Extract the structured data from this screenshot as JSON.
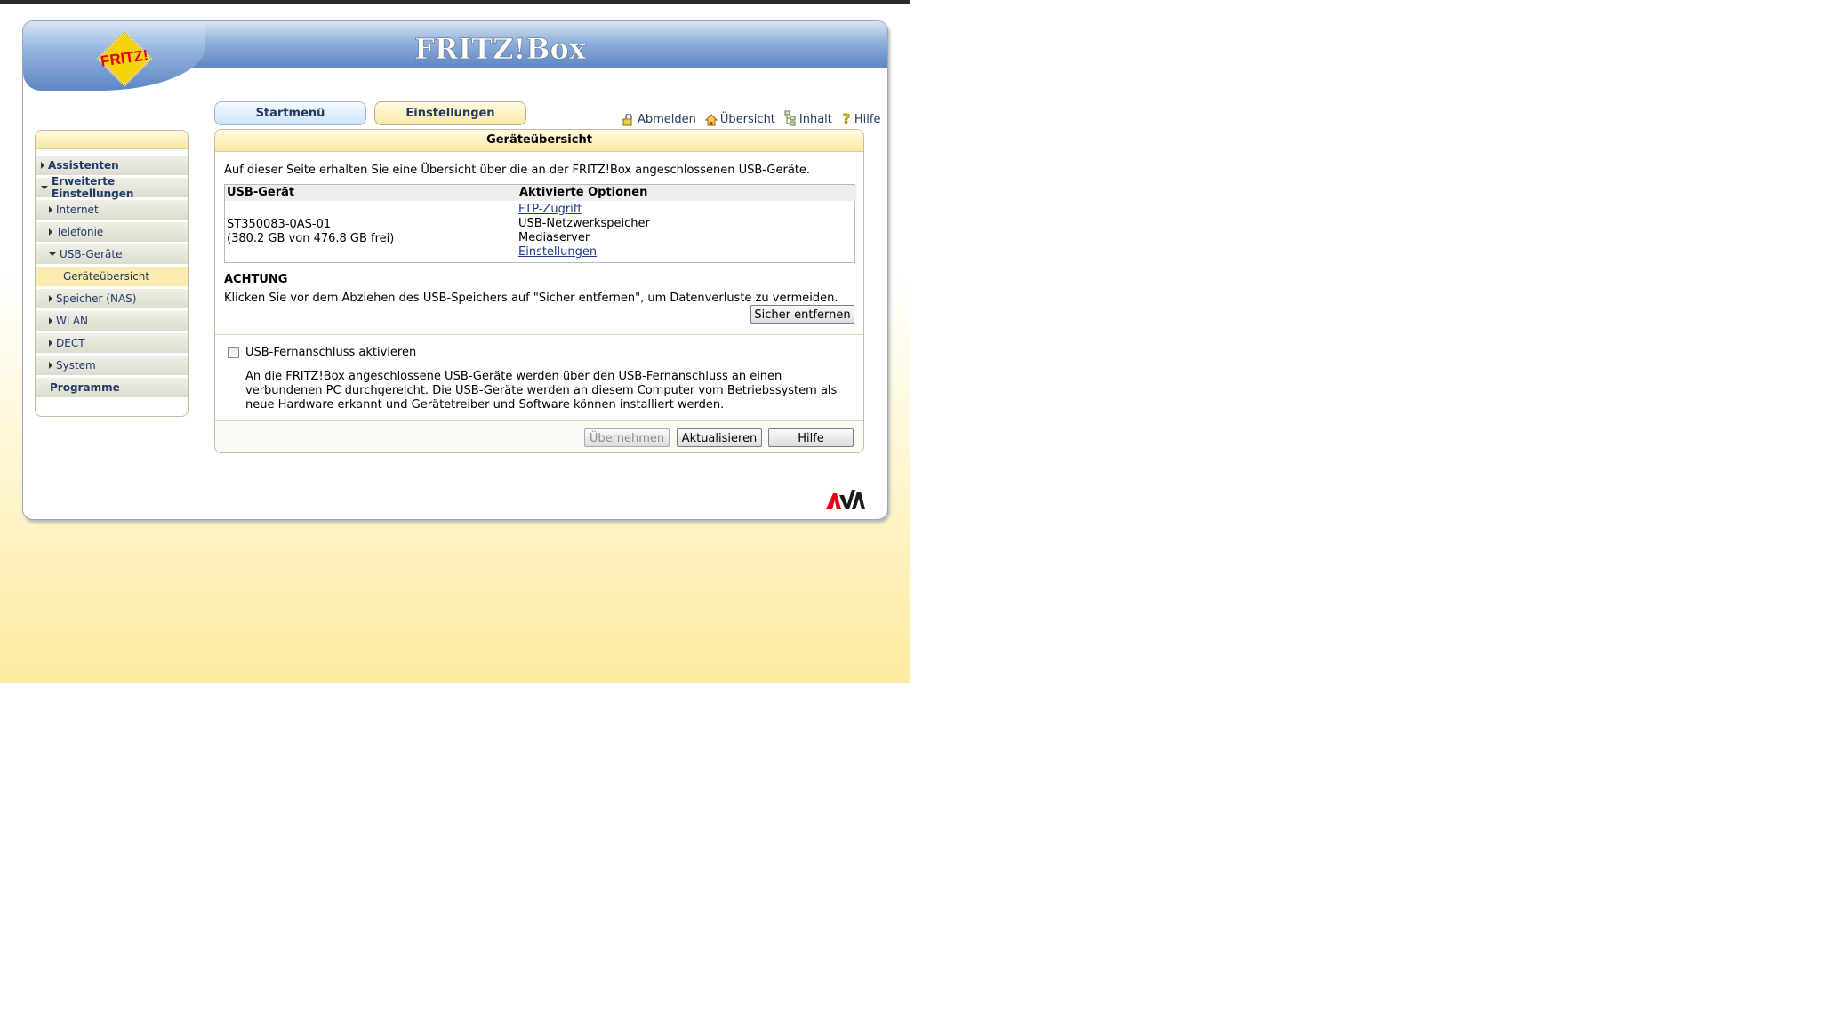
{
  "header": {
    "brand": "FRITZ!Box",
    "logo_text": "FRITZ!"
  },
  "tabs": [
    {
      "label": "Startmenü"
    },
    {
      "label": "Einstellungen"
    }
  ],
  "toplinks": [
    {
      "label": "Abmelden",
      "icon": "logout-icon"
    },
    {
      "label": "Übersicht",
      "icon": "home-icon"
    },
    {
      "label": "Inhalt",
      "icon": "sitemap-icon"
    },
    {
      "label": "Hilfe",
      "icon": "help-icon"
    }
  ],
  "sidebar": {
    "items": [
      {
        "label": "Assistenten"
      },
      {
        "label": "Erweiterte Einstellungen"
      },
      {
        "label": "Internet"
      },
      {
        "label": "Telefonie"
      },
      {
        "label": "USB-Geräte"
      },
      {
        "label": "Geräteübersicht"
      },
      {
        "label": "Speicher (NAS)"
      },
      {
        "label": "WLAN"
      },
      {
        "label": "DECT"
      },
      {
        "label": "System"
      },
      {
        "label": "Programme"
      }
    ]
  },
  "main": {
    "title": "Geräteübersicht",
    "intro": "Auf dieser Seite erhalten Sie eine Übersicht über die an der FRITZ!Box angeschlossenen USB-Geräte.",
    "table": {
      "col1": "USB-Gerät",
      "col2": "Aktivierte Optionen",
      "device_name": "ST350083-0AS-01",
      "device_space": "(380.2 GB von 476.8 GB frei)",
      "options": [
        "FTP-Zugriff",
        "USB-Netzwerkspeicher",
        "Mediaserver",
        "Einstellungen"
      ]
    },
    "warning_title": "ACHTUNG",
    "warning_text": "Klicken Sie vor dem Abziehen des USB-Speichers auf \"Sicher entfernen\", um Datenverluste zu vermeiden.",
    "remove_button": "Sicher entfernen",
    "checkbox_label": "USB-Fernanschluss aktivieren",
    "checkbox_checked": false,
    "description": "An die FRITZ!Box angeschlossene USB-Geräte werden über den USB-Fernanschluss an einen verbundenen PC durchgereicht. Die USB-Geräte werden an diesem Computer vom Betriebssystem als neue Hardware erkannt und Gerätetreiber und Software können installiert werden.",
    "buttons": {
      "apply": "Übernehmen",
      "refresh": "Aktualisieren",
      "help": "Hilfe"
    }
  },
  "colors": {
    "accent_yellow": "#fbe7a2",
    "header_blue": "#5d86c4",
    "link_blue": "#1d3a8a"
  }
}
